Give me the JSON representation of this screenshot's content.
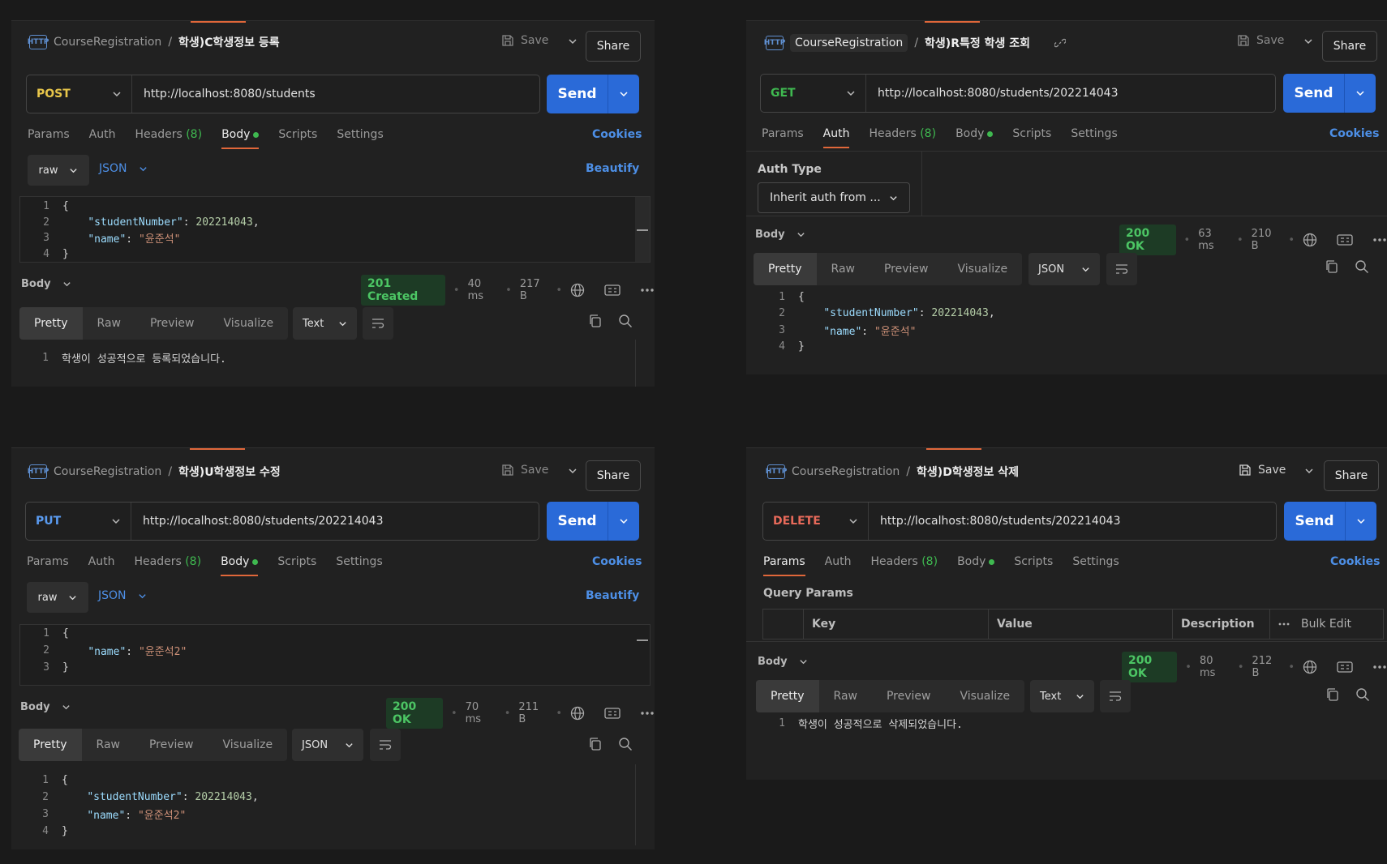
{
  "panels": [
    {
      "collection": "CourseRegistration",
      "request_name": "학생)C학생정보 등록",
      "save_label": "Save",
      "share_label": "Share",
      "method": "POST",
      "method_color": "#e8c64a",
      "url": "http://localhost:8080/students",
      "send_label": "Send",
      "tabs": {
        "params": "Params",
        "auth": "Auth",
        "headers": "Headers",
        "headers_count": "(8)",
        "body": "Body",
        "scripts": "Scripts",
        "settings": "Settings"
      },
      "active_tab": "Body",
      "cookies": "Cookies",
      "body_mode": "raw",
      "body_lang": "JSON",
      "beautify": "Beautify",
      "request_lines": [
        "{",
        "    \"studentNumber\": 202214043,",
        "    \"name\": \"윤준석\"",
        "}"
      ],
      "response": {
        "label": "Body",
        "status": "201 Created",
        "time": "40 ms",
        "size": "217 B",
        "format": "Text",
        "view_tabs": [
          "Pretty",
          "Raw",
          "Preview",
          "Visualize"
        ],
        "lines": [
          "학생이 성공적으로 등록되었습니다."
        ]
      }
    },
    {
      "collection": "CourseRegistration",
      "request_name": "학생)R특정 학생 조회",
      "save_label": "Save",
      "share_label": "Share",
      "method": "GET",
      "method_color": "#3fb950",
      "url": "http://localhost:8080/students/202214043",
      "send_label": "Send",
      "tabs": {
        "params": "Params",
        "auth": "Auth",
        "headers": "Headers",
        "headers_count": "(8)",
        "body": "Body",
        "scripts": "Scripts",
        "settings": "Settings"
      },
      "active_tab": "Auth",
      "cookies": "Cookies",
      "auth_type_label": "Auth Type",
      "auth_type_value": "Inherit auth from ...",
      "response": {
        "label": "Body",
        "status": "200 OK",
        "time": "63 ms",
        "size": "210 B",
        "format": "JSON",
        "view_tabs": [
          "Pretty",
          "Raw",
          "Preview",
          "Visualize"
        ],
        "lines": [
          "{",
          "    \"studentNumber\": 202214043,",
          "    \"name\": \"윤준석\"",
          "}"
        ]
      }
    },
    {
      "collection": "CourseRegistration",
      "request_name": "학생)U학생정보 수정",
      "save_label": "Save",
      "share_label": "Share",
      "method": "PUT",
      "method_color": "#5a9bf0",
      "url": "http://localhost:8080/students/202214043",
      "send_label": "Send",
      "tabs": {
        "params": "Params",
        "auth": "Auth",
        "headers": "Headers",
        "headers_count": "(8)",
        "body": "Body",
        "scripts": "Scripts",
        "settings": "Settings"
      },
      "active_tab": "Body",
      "cookies": "Cookies",
      "body_mode": "raw",
      "body_lang": "JSON",
      "beautify": "Beautify",
      "request_lines": [
        "{",
        "    \"name\": \"윤준석2\"",
        "}"
      ],
      "response": {
        "label": "Body",
        "status": "200 OK",
        "time": "70 ms",
        "size": "211 B",
        "format": "JSON",
        "view_tabs": [
          "Pretty",
          "Raw",
          "Preview",
          "Visualize"
        ],
        "lines": [
          "{",
          "    \"studentNumber\": 202214043,",
          "    \"name\": \"윤준석2\"",
          "}"
        ]
      }
    },
    {
      "collection": "CourseRegistration",
      "request_name": "학생)D학생정보 삭제",
      "save_label": "Save",
      "share_label": "Share",
      "method": "DELETE",
      "method_color": "#e86a5a",
      "url": "http://localhost:8080/students/202214043",
      "send_label": "Send",
      "tabs": {
        "params": "Params",
        "auth": "Auth",
        "headers": "Headers",
        "headers_count": "(8)",
        "body": "Body",
        "scripts": "Scripts",
        "settings": "Settings"
      },
      "active_tab": "Params",
      "cookies": "Cookies",
      "query_params_label": "Query Params",
      "query_columns": {
        "key": "Key",
        "value": "Value",
        "description": "Description",
        "bulk_edit": "Bulk Edit"
      },
      "response": {
        "label": "Body",
        "status": "200 OK",
        "time": "80 ms",
        "size": "212 B",
        "format": "Text",
        "view_tabs": [
          "Pretty",
          "Raw",
          "Preview",
          "Visualize"
        ],
        "lines": [
          "학생이 성공적으로 삭제되었습니다."
        ]
      }
    }
  ],
  "icons": {
    "http": "http-icon",
    "save": "save-icon",
    "link": "link-icon",
    "chevron": "chevron-down-icon",
    "globe": "globe-icon",
    "save_response": "save-response-icon",
    "more": "more-icon",
    "copy": "copy-icon",
    "search": "search-icon",
    "wrap": "wrap-lines-icon"
  }
}
